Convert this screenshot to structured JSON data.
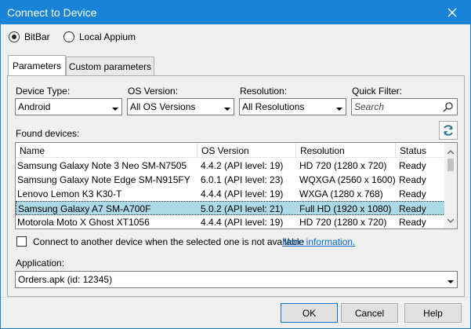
{
  "window": {
    "title": "Connect to Device"
  },
  "source": {
    "options": [
      "BitBar",
      "Local Appium"
    ],
    "selected": "BitBar"
  },
  "tabs": [
    {
      "label": "Parameters",
      "active": true
    },
    {
      "label": "Custom parameters",
      "active": false
    }
  ],
  "filters": {
    "device_type": {
      "label": "Device Type:",
      "value": "Android"
    },
    "os_version": {
      "label": "OS Version:",
      "value": "All OS Versions"
    },
    "resolution": {
      "label": "Resolution:",
      "value": "All Resolutions"
    },
    "quick_filter": {
      "label": "Quick Filter:",
      "placeholder": "Search"
    }
  },
  "found_devices": {
    "label": "Found devices:",
    "columns": [
      "Name",
      "OS Version",
      "Resolution",
      "Status"
    ],
    "rows": [
      {
        "name": "Samsung Galaxy Note 3 Neo SM-N7505",
        "os": "4.4.2 (API level: 19)",
        "resolution": "HD 720 (1280 x 720)",
        "status": "Ready",
        "selected": false
      },
      {
        "name": "Samsung Galaxy Note Edge SM-N915FY",
        "os": "6.0.1 (API level: 23)",
        "resolution": "WQXGA (2560 x 1600)",
        "status": "Ready",
        "selected": false
      },
      {
        "name": "Lenovo Lemon K3 K30-T",
        "os": "4.4.4 (API level: 19)",
        "resolution": "WXGA (1280 x 768)",
        "status": "Ready",
        "selected": false
      },
      {
        "name": "Samsung Galaxy A7 SM-A700F",
        "os": "5.0.2 (API level: 21)",
        "resolution": "Full HD (1920 x 1080)",
        "status": "Ready",
        "selected": true
      },
      {
        "name": "Motorola Moto X Ghost XT1056",
        "os": "4.4.4 (API level: 19)",
        "resolution": "HD 720 (1280 x 720)",
        "status": "Ready",
        "selected": false
      }
    ]
  },
  "reconnect": {
    "label": "Connect to another device when the selected one is not available",
    "link": "More information.",
    "checked": false
  },
  "application": {
    "label": "Application:",
    "value": "Orders.apk (id: 12345)"
  },
  "buttons": {
    "ok": "OK",
    "cancel": "Cancel",
    "help": "Help"
  },
  "colors": {
    "titlebar": "#1883d7",
    "selected_row": "#add8e6",
    "link": "#0066cc"
  }
}
